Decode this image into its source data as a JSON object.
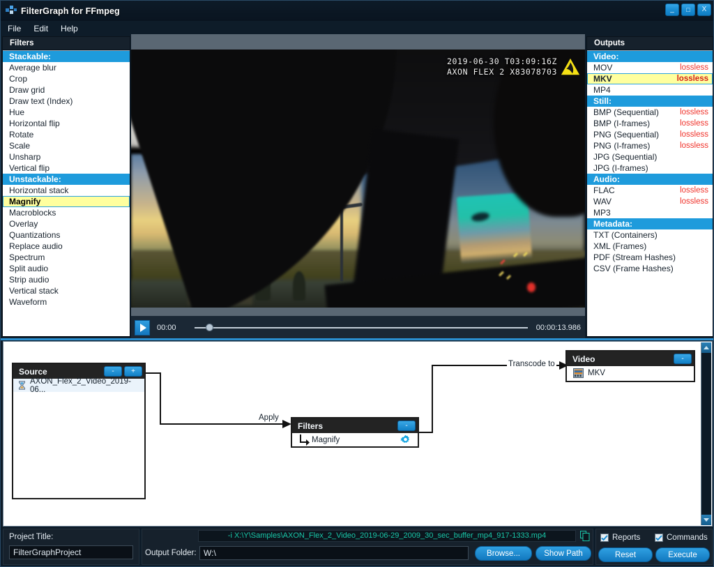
{
  "window": {
    "title": "FilterGraph for FFmpeg",
    "app_icon": "app-logo-icon",
    "minimize": "_",
    "maximize": "□",
    "close": "X"
  },
  "menubar": {
    "items": [
      "File",
      "Edit",
      "Help"
    ]
  },
  "filters_panel": {
    "header": "Filters",
    "items": [
      {
        "label": "Stackable:",
        "type": "group"
      },
      {
        "label": "Average blur",
        "type": "item"
      },
      {
        "label": "Crop",
        "type": "item"
      },
      {
        "label": "Draw grid",
        "type": "item"
      },
      {
        "label": "Draw text (Index)",
        "type": "item"
      },
      {
        "label": "Hue",
        "type": "item"
      },
      {
        "label": "Horizontal flip",
        "type": "item"
      },
      {
        "label": "Rotate",
        "type": "item"
      },
      {
        "label": "Scale",
        "type": "item"
      },
      {
        "label": "Unsharp",
        "type": "item"
      },
      {
        "label": "Vertical flip",
        "type": "item"
      },
      {
        "label": "Unstackable:",
        "type": "group"
      },
      {
        "label": "Horizontal stack",
        "type": "item"
      },
      {
        "label": "Magnify",
        "type": "selected"
      },
      {
        "label": "Macroblocks",
        "type": "item"
      },
      {
        "label": "Overlay",
        "type": "item"
      },
      {
        "label": "Quantizations",
        "type": "item"
      },
      {
        "label": "Replace audio",
        "type": "item"
      },
      {
        "label": "Spectrum",
        "type": "item"
      },
      {
        "label": "Split audio",
        "type": "item"
      },
      {
        "label": "Strip audio",
        "type": "item"
      },
      {
        "label": "Vertical stack",
        "type": "item"
      },
      {
        "label": "Waveform",
        "type": "item"
      }
    ]
  },
  "outputs_panel": {
    "header": "Outputs",
    "items": [
      {
        "label": "Video:",
        "tag": "",
        "type": "group"
      },
      {
        "label": "MOV",
        "tag": "lossless",
        "type": "item"
      },
      {
        "label": "MKV",
        "tag": "lossless",
        "type": "selected"
      },
      {
        "label": "MP4",
        "tag": "",
        "type": "item"
      },
      {
        "label": "Still:",
        "tag": "",
        "type": "group"
      },
      {
        "label": "BMP (Sequential)",
        "tag": "lossless",
        "type": "item"
      },
      {
        "label": "BMP (I-frames)",
        "tag": "lossless",
        "type": "item"
      },
      {
        "label": "PNG (Sequential)",
        "tag": "lossless",
        "type": "item"
      },
      {
        "label": "PNG (I-frames)",
        "tag": "lossless",
        "type": "item"
      },
      {
        "label": "JPG (Sequential)",
        "tag": "",
        "type": "item"
      },
      {
        "label": "JPG (I-frames)",
        "tag": "",
        "type": "item"
      },
      {
        "label": "Audio:",
        "tag": "",
        "type": "group"
      },
      {
        "label": "FLAC",
        "tag": "lossless",
        "type": "item"
      },
      {
        "label": "WAV",
        "tag": "lossless",
        "type": "item"
      },
      {
        "label": "MP3",
        "tag": "",
        "type": "item"
      },
      {
        "label": "Metadata:",
        "tag": "",
        "type": "group"
      },
      {
        "label": "TXT (Containers)",
        "tag": "",
        "type": "item"
      },
      {
        "label": "XML (Frames)",
        "tag": "",
        "type": "item"
      },
      {
        "label": "PDF (Stream Hashes)",
        "tag": "",
        "type": "item"
      },
      {
        "label": "CSV (Frame Hashes)",
        "tag": "",
        "type": "item"
      }
    ]
  },
  "preview": {
    "overlay_line1": "2019-06-30 T03:09:16Z",
    "overlay_line2": "AXON FLEX 2 X83078703",
    "watermark_icon": "axon-logo-icon",
    "player": {
      "play_icon": "play-icon",
      "current_time": "00:00",
      "total_time": "00:00:13.986",
      "progress_percent": 3.4
    }
  },
  "graph": {
    "source_node": {
      "title": "Source",
      "remove_label": "-",
      "add_label": "+",
      "item_icon": "hourglass-icon",
      "item_label": "AXON_Flex_2_Video_2019-06..."
    },
    "filters_node": {
      "title": "Filters",
      "remove_label": "-",
      "item_label": "Magnify",
      "settings_icon": "gear-icon",
      "branch_icon": "elbow-arrow-icon"
    },
    "video_node": {
      "title": "Video",
      "remove_label": "-",
      "item_icon": "film-icon",
      "item_label": "MKV"
    },
    "edges": [
      {
        "label": "Apply"
      },
      {
        "label": "Transcode to"
      }
    ],
    "scrollbar": {
      "up_icon": "chevron-up-icon",
      "down_icon": "chevron-down-icon"
    }
  },
  "bottom": {
    "project_title_label": "Project Title:",
    "project_title_value": "FilterGraphProject",
    "command_line": "-i X:\\Y\\Samples\\AXON_Flex_2_Video_2019-06-29_2009_30_sec_buffer_mp4_917-1333.mp4",
    "copy_icon": "copy-icon",
    "output_folder_label": "Output Folder:",
    "output_folder_value": "W:\\",
    "browse_label": "Browse...",
    "show_path_label": "Show Path",
    "reports_label": "Reports",
    "commands_label": "Commands",
    "reset_label": "Reset",
    "execute_label": "Execute"
  },
  "colors": {
    "accent_blue": "#1e9bdc",
    "selection_yellow": "#ffff9e",
    "lossless_red": "#f0322a",
    "command_teal": "#19c6a8",
    "panel_dark": "#16212c"
  }
}
